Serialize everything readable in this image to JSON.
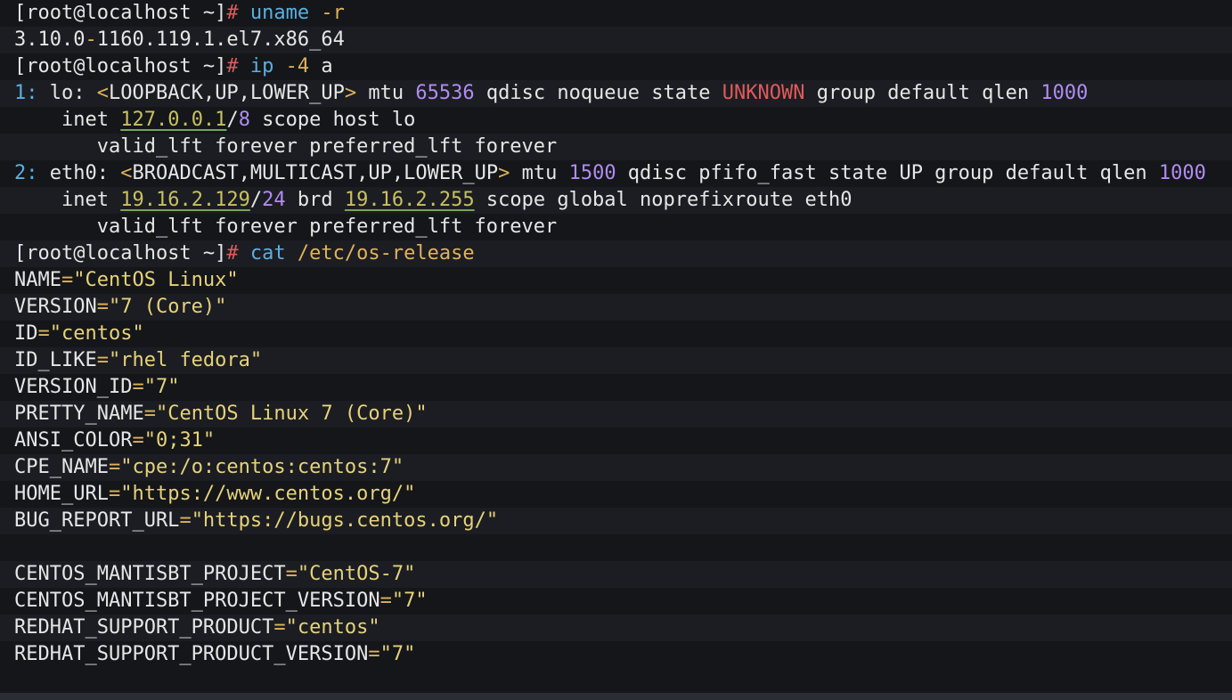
{
  "colors": {
    "background": "#14161a",
    "alt_band": "#1b1d22",
    "text": "#e6e6e6",
    "prompt": "#e6e6e6",
    "command": "#5ab0e0",
    "argument": "#e0b35a",
    "number": "#b18cf0",
    "address": "#c8c060",
    "red": "#e05a5a",
    "string": "#e6d27a",
    "cursor": "#f5a623"
  },
  "lines": [
    {
      "segments": [
        {
          "text": "[root@localhost ~]",
          "color": "prompt"
        },
        {
          "text": "# ",
          "color": "red"
        },
        {
          "text": "uname",
          "color": "command"
        },
        {
          "text": " -r",
          "color": "argument"
        }
      ]
    },
    {
      "segments": [
        {
          "text": "3.10.0",
          "color": "text"
        },
        {
          "text": "-",
          "color": "argument"
        },
        {
          "text": "1160.119.1.el7.x86_64",
          "color": "text"
        }
      ]
    },
    {
      "segments": [
        {
          "text": "[root@localhost ~]",
          "color": "prompt"
        },
        {
          "text": "# ",
          "color": "red"
        },
        {
          "text": "ip",
          "color": "command"
        },
        {
          "text": " -4",
          "color": "argument"
        },
        {
          "text": " a",
          "color": "text"
        }
      ]
    },
    {
      "segments": [
        {
          "text": "1: ",
          "color": "command"
        },
        {
          "text": "lo: ",
          "color": "text"
        },
        {
          "text": "<",
          "color": "argument"
        },
        {
          "text": "LOOPBACK,UP,LOWER_UP",
          "color": "text"
        },
        {
          "text": ">",
          "color": "argument"
        },
        {
          "text": " mtu ",
          "color": "text"
        },
        {
          "text": "65536",
          "color": "number"
        },
        {
          "text": " qdisc noqueue state ",
          "color": "text"
        },
        {
          "text": "UNKNOWN",
          "color": "red"
        },
        {
          "text": " group default qlen ",
          "color": "text"
        },
        {
          "text": "1000",
          "color": "number"
        }
      ]
    },
    {
      "segments": [
        {
          "text": "    inet ",
          "color": "text"
        },
        {
          "text": "127.0.0.1",
          "color": "address",
          "underline": true
        },
        {
          "text": "/",
          "color": "text"
        },
        {
          "text": "8",
          "color": "number"
        },
        {
          "text": " scope host lo",
          "color": "text"
        }
      ]
    },
    {
      "segments": [
        {
          "text": "       valid_lft forever preferred_lft forever",
          "color": "text"
        }
      ]
    },
    {
      "segments": [
        {
          "text": "2: ",
          "color": "command"
        },
        {
          "text": "eth0: ",
          "color": "text"
        },
        {
          "text": "<",
          "color": "argument"
        },
        {
          "text": "BROADCAST,MULTICAST,UP,LOWER_UP",
          "color": "text"
        },
        {
          "text": ">",
          "color": "argument"
        },
        {
          "text": " mtu ",
          "color": "text"
        },
        {
          "text": "1500",
          "color": "number"
        },
        {
          "text": " qdisc pfifo_fast state UP group default qlen ",
          "color": "text"
        },
        {
          "text": "1000",
          "color": "number"
        }
      ]
    },
    {
      "segments": [
        {
          "text": "    inet ",
          "color": "text"
        },
        {
          "text": "19.16.2.129",
          "color": "address",
          "underline": true
        },
        {
          "text": "/",
          "color": "text"
        },
        {
          "text": "24",
          "color": "number"
        },
        {
          "text": " brd ",
          "color": "text"
        },
        {
          "text": "19.16.2.255",
          "color": "address",
          "underline": true
        },
        {
          "text": " scope global noprefixroute eth0",
          "color": "text"
        }
      ]
    },
    {
      "segments": [
        {
          "text": "       valid_lft forever preferred_lft forever",
          "color": "text"
        }
      ]
    },
    {
      "segments": [
        {
          "text": "[root@localhost ~]",
          "color": "prompt"
        },
        {
          "text": "# ",
          "color": "red"
        },
        {
          "text": "cat",
          "color": "command"
        },
        {
          "text": " /etc/os-release",
          "color": "argument"
        }
      ]
    },
    {
      "segments": [
        {
          "text": "NAME",
          "color": "text"
        },
        {
          "text": "=",
          "color": "argument"
        },
        {
          "text": "\"CentOS Linux\"",
          "color": "string"
        }
      ]
    },
    {
      "segments": [
        {
          "text": "VERSION",
          "color": "text"
        },
        {
          "text": "=",
          "color": "argument"
        },
        {
          "text": "\"7 (Core)\"",
          "color": "string"
        }
      ]
    },
    {
      "segments": [
        {
          "text": "ID",
          "color": "text"
        },
        {
          "text": "=",
          "color": "argument"
        },
        {
          "text": "\"centos\"",
          "color": "string"
        }
      ]
    },
    {
      "segments": [
        {
          "text": "ID_LIKE",
          "color": "text"
        },
        {
          "text": "=",
          "color": "argument"
        },
        {
          "text": "\"rhel fedora\"",
          "color": "string"
        }
      ]
    },
    {
      "segments": [
        {
          "text": "VERSION_ID",
          "color": "text"
        },
        {
          "text": "=",
          "color": "argument"
        },
        {
          "text": "\"7\"",
          "color": "string"
        }
      ]
    },
    {
      "segments": [
        {
          "text": "PRETTY_NAME",
          "color": "text"
        },
        {
          "text": "=",
          "color": "argument"
        },
        {
          "text": "\"CentOS Linux 7 (Core)\"",
          "color": "string"
        }
      ]
    },
    {
      "segments": [
        {
          "text": "ANSI_COLOR",
          "color": "text"
        },
        {
          "text": "=",
          "color": "argument"
        },
        {
          "text": "\"0;31\"",
          "color": "string"
        }
      ]
    },
    {
      "segments": [
        {
          "text": "CPE_NAME",
          "color": "text"
        },
        {
          "text": "=",
          "color": "argument"
        },
        {
          "text": "\"cpe:/o:centos:centos:7\"",
          "color": "string"
        }
      ]
    },
    {
      "segments": [
        {
          "text": "HOME_URL",
          "color": "text"
        },
        {
          "text": "=",
          "color": "argument"
        },
        {
          "text": "\"https://www.centos.org/\"",
          "color": "string"
        }
      ]
    },
    {
      "segments": [
        {
          "text": "BUG_REPORT_URL",
          "color": "text"
        },
        {
          "text": "=",
          "color": "argument"
        },
        {
          "text": "\"https://bugs.centos.org/\"",
          "color": "string"
        }
      ]
    },
    {
      "segments": [
        {
          "text": "",
          "color": "text"
        }
      ]
    },
    {
      "segments": [
        {
          "text": "CENTOS_MANTISBT_PROJECT",
          "color": "text"
        },
        {
          "text": "=",
          "color": "argument"
        },
        {
          "text": "\"CentOS-7\"",
          "color": "string"
        }
      ]
    },
    {
      "segments": [
        {
          "text": "CENTOS_MANTISBT_PROJECT_VERSION",
          "color": "text"
        },
        {
          "text": "=",
          "color": "argument"
        },
        {
          "text": "\"7\"",
          "color": "string"
        }
      ]
    },
    {
      "segments": [
        {
          "text": "REDHAT_SUPPORT_PRODUCT",
          "color": "text"
        },
        {
          "text": "=",
          "color": "argument"
        },
        {
          "text": "\"centos\"",
          "color": "string"
        }
      ]
    },
    {
      "segments": [
        {
          "text": "REDHAT_SUPPORT_PRODUCT_VERSION",
          "color": "text"
        },
        {
          "text": "=",
          "color": "argument"
        },
        {
          "text": "\"7\"",
          "color": "string"
        }
      ]
    }
  ],
  "cursor": {
    "visible": true
  }
}
